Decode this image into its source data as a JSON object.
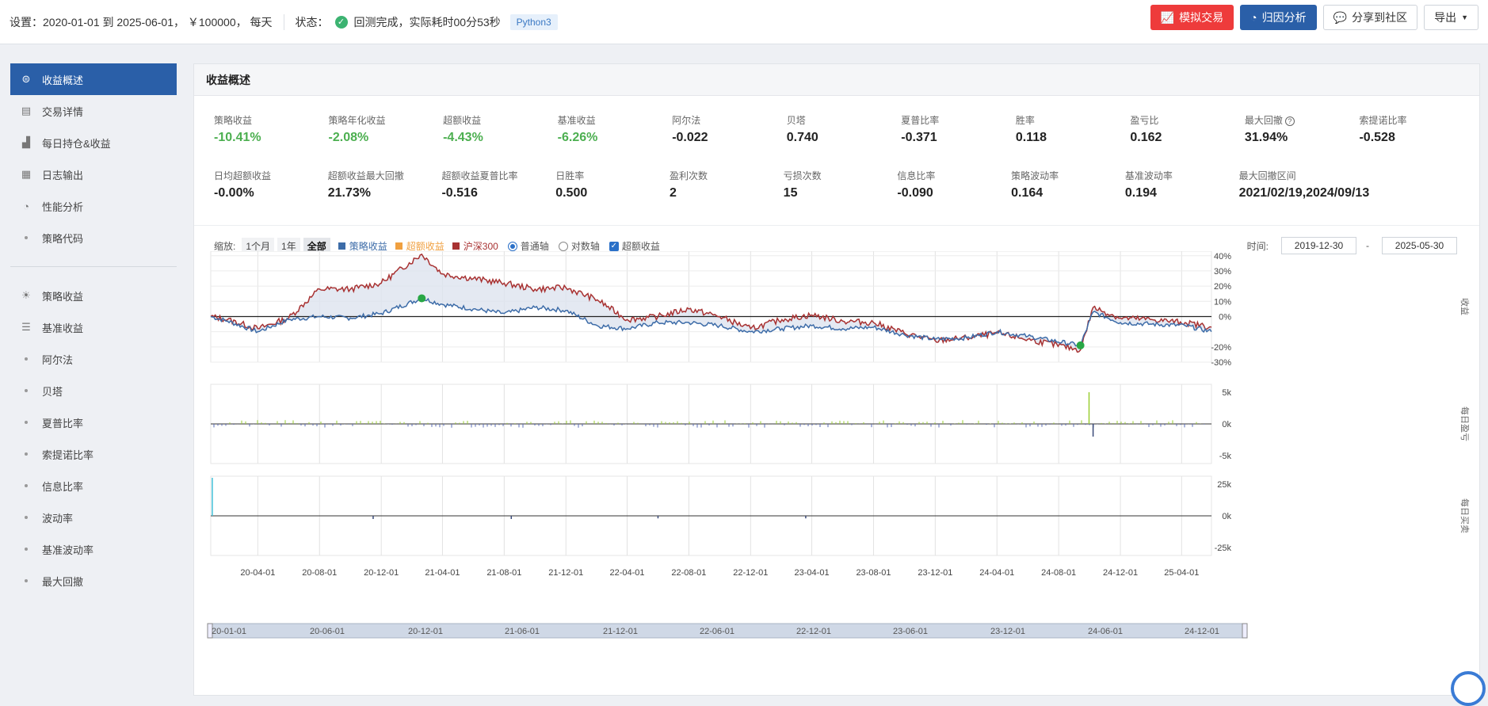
{
  "topbar": {
    "settings_label": "设置：",
    "settings_value": "2020-01-01 到 2025-06-01， ￥100000， 每天",
    "status_label": "状态：",
    "status_value": "回测完成，实际耗时00分53秒",
    "lang_tag": "Python3",
    "btn_sim": "模拟交易",
    "btn_attr": "归因分析",
    "btn_share": "分享到社区",
    "btn_export": "导出"
  },
  "sidebar": {
    "items": [
      {
        "label": "收益概述",
        "icon": "dollar-icon"
      },
      {
        "label": "交易详情",
        "icon": "list-icon"
      },
      {
        "label": "每日持仓&收益",
        "icon": "chart-icon"
      },
      {
        "label": "日志输出",
        "icon": "calendar-icon"
      },
      {
        "label": "性能分析",
        "icon": "pie-icon"
      },
      {
        "label": "策略代码",
        "icon": "dot"
      }
    ],
    "items2": [
      {
        "label": "策略收益",
        "icon": "bulb-icon"
      },
      {
        "label": "基准收益",
        "icon": "database-icon"
      },
      {
        "label": "阿尔法"
      },
      {
        "label": "贝塔"
      },
      {
        "label": "夏普比率"
      },
      {
        "label": "索提诺比率"
      },
      {
        "label": "信息比率"
      },
      {
        "label": "波动率"
      },
      {
        "label": "基准波动率"
      },
      {
        "label": "最大回撤"
      }
    ]
  },
  "main": {
    "title": "收益概述",
    "metrics_row1": [
      {
        "label": "策略收益",
        "value": "-10.41%",
        "green": true
      },
      {
        "label": "策略年化收益",
        "value": "-2.08%",
        "green": true
      },
      {
        "label": "超额收益",
        "value": "-4.43%",
        "green": true
      },
      {
        "label": "基准收益",
        "value": "-6.26%",
        "green": true
      },
      {
        "label": "阿尔法",
        "value": "-0.022"
      },
      {
        "label": "贝塔",
        "value": "0.740"
      },
      {
        "label": "夏普比率",
        "value": "-0.371"
      },
      {
        "label": "胜率",
        "value": "0.118"
      },
      {
        "label": "盈亏比",
        "value": "0.162"
      },
      {
        "label": "最大回撤",
        "value": "31.94%",
        "help": "?"
      },
      {
        "label": "索提诺比率",
        "value": "-0.528"
      }
    ],
    "metrics_row2": [
      {
        "label": "日均超额收益",
        "value": "-0.00%"
      },
      {
        "label": "超额收益最大回撤",
        "value": "21.73%"
      },
      {
        "label": "超额收益夏普比率",
        "value": "-0.516"
      },
      {
        "label": "日胜率",
        "value": "0.500"
      },
      {
        "label": "盈利次数",
        "value": "2"
      },
      {
        "label": "亏损次数",
        "value": "15"
      },
      {
        "label": "信息比率",
        "value": "-0.090"
      },
      {
        "label": "策略波动率",
        "value": "0.164"
      },
      {
        "label": "基准波动率",
        "value": "0.194"
      },
      {
        "label": "最大回撤区间",
        "value": "2021/02/19,2024/09/13"
      }
    ],
    "zoom_label": "缩放:",
    "zoom_opts": [
      "1个月",
      "1年",
      "全部"
    ],
    "legend": {
      "strategy": "策略收益",
      "excess": "超额收益",
      "bench": "沪深300",
      "normal_axis": "普通轴",
      "log_axis": "对数轴",
      "excess_chk": "超额收益"
    },
    "time_label": "时间:",
    "time_from": "2019-12-30",
    "time_dash": "-",
    "time_to": "2025-05-30"
  },
  "chart_data": [
    {
      "type": "line",
      "ylabel": "收益",
      "y_ticks": [
        "40%",
        "30%",
        "20%",
        "10%",
        "0%",
        "-20%",
        "-30%"
      ],
      "ylim": [
        -30,
        43
      ],
      "colors": {
        "strategy": "#3d6ca8",
        "bench": "#a83232",
        "fill": "#dde4ef"
      },
      "x": [
        "2019-12-30",
        "2020-02-01",
        "2020-04-01",
        "2020-06-01",
        "2020-08-01",
        "2020-10-01",
        "2020-12-01",
        "2021-02-19",
        "2021-04-01",
        "2021-06-01",
        "2021-08-01",
        "2021-10-01",
        "2021-12-01",
        "2022-02-01",
        "2022-04-01",
        "2022-06-01",
        "2022-08-01",
        "2022-10-01",
        "2022-12-01",
        "2023-02-01",
        "2023-04-01",
        "2023-06-01",
        "2023-08-01",
        "2023-10-01",
        "2023-12-01",
        "2024-02-01",
        "2024-04-01",
        "2024-06-01",
        "2024-09-13",
        "2024-10-08",
        "2024-12-01",
        "2025-02-01",
        "2025-04-08",
        "2025-05-30"
      ],
      "series": [
        {
          "name": "策略收益",
          "values": [
            0,
            -3,
            -10,
            -2,
            0,
            -1,
            2,
            12,
            8,
            5,
            2,
            6,
            4,
            -6,
            -8,
            -4,
            -4,
            -6,
            -10,
            -8,
            -6,
            -8,
            -7,
            -12,
            -15,
            -14,
            -10,
            -13,
            -19,
            3,
            -4,
            -5,
            -6,
            -10
          ]
        },
        {
          "name": "沪深300",
          "values": [
            0,
            -2,
            -8,
            -1,
            18,
            18,
            22,
            41,
            28,
            25,
            22,
            18,
            19,
            11,
            -2,
            0,
            5,
            0,
            -8,
            -2,
            1,
            -3,
            -4,
            -11,
            -16,
            -14,
            -11,
            -15,
            -22,
            6,
            -1,
            -2,
            -4,
            -7
          ]
        }
      ],
      "markers": [
        {
          "x": "2021-02-19",
          "y": 12
        },
        {
          "x": "2024-09-13",
          "y": -19
        }
      ]
    },
    {
      "type": "bar",
      "ylabel": "每日盈亏",
      "y_ticks": [
        "5k",
        "0k",
        "-5k"
      ],
      "ylim": [
        -5000,
        5000
      ],
      "spikes": [
        {
          "x": "2024-09-30",
          "value": 5000
        },
        {
          "x": "2024-10-08",
          "value": -2000
        }
      ]
    },
    {
      "type": "bar",
      "ylabel": "每日买卖",
      "y_ticks": [
        "25k",
        "0k",
        "-25k"
      ],
      "ylim": [
        -25000,
        25000
      ],
      "spikes": [
        {
          "x": "2020-01-02",
          "value": 30000
        },
        {
          "x": "2020-11-15",
          "value": -2500
        },
        {
          "x": "2021-08-15",
          "value": -2500
        },
        {
          "x": "2022-06-01",
          "value": -2000
        },
        {
          "x": "2023-03-20",
          "value": -2000
        }
      ]
    }
  ],
  "x_axis_labels": [
    "20-04-01",
    "20-08-01",
    "20-12-01",
    "21-04-01",
    "21-08-01",
    "21-12-01",
    "22-04-01",
    "22-08-01",
    "22-12-01",
    "23-04-01",
    "23-08-01",
    "23-12-01",
    "24-04-01",
    "24-08-01",
    "24-12-01",
    "25-04-01"
  ],
  "navigator_labels": [
    "20-01-01",
    "20-06-01",
    "20-12-01",
    "21-06-01",
    "21-12-01",
    "22-06-01",
    "22-12-01",
    "23-06-01",
    "23-12-01",
    "24-06-01",
    "24-12-01"
  ]
}
